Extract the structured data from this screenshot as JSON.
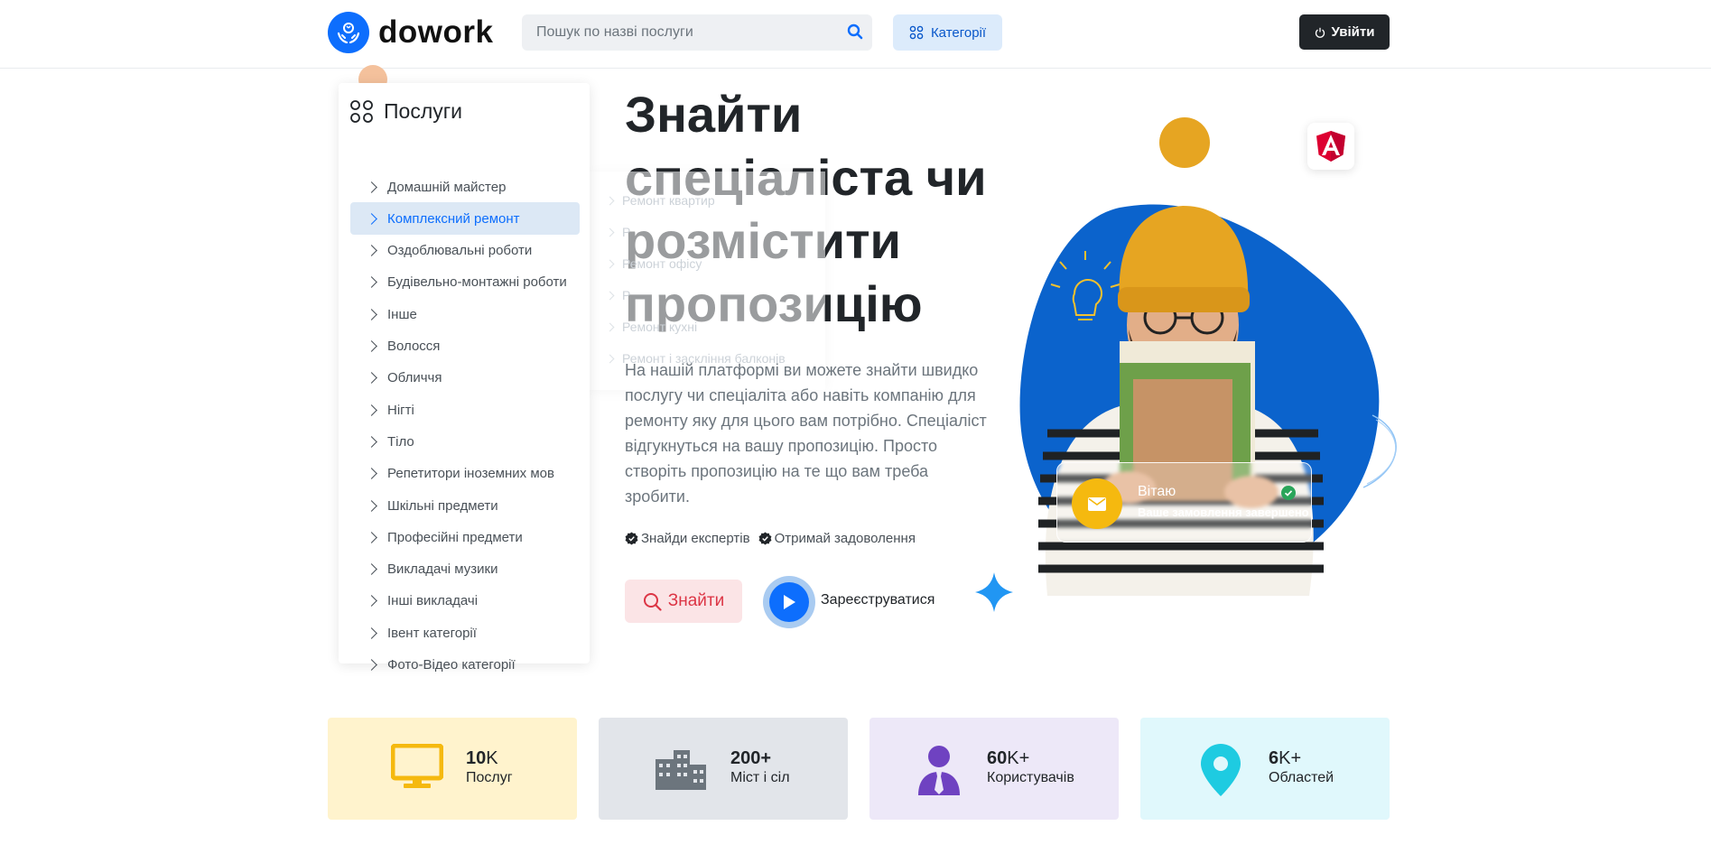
{
  "header": {
    "brand": "dowork",
    "search_placeholder": "Пошук по назві послуги",
    "categories_label": "Категорії",
    "login_label": "Увійти"
  },
  "services": {
    "title": "Послуги",
    "items": [
      "Домашній майстер",
      "Комплексний ремонт",
      "Оздоблювальні роботи",
      "Будівельно-монтажні роботи",
      "Інше",
      "Волосся",
      "Обличчя",
      "Нігті",
      "Тіло",
      "Репетитори іноземних мов",
      "Шкільні предмети",
      "Професійні предмети",
      "Викладачі музики",
      "Інші викладачі",
      "Івент категорії",
      "Фото-Відео категорії"
    ],
    "active_index": 1
  },
  "submenu": {
    "items": [
      "Ремонт квартир",
      "Р",
      "Ремонт офісу",
      "Р",
      "Ремонт кухні",
      "Ремонт і заскління балконів"
    ]
  },
  "hero": {
    "title": "Знайти спеціаліста чи розмістити пропозицію",
    "description": "На нашій платформі ви можете знайти швидко послугу чи спеціаліта або навіть компанію для ремонту яку для цього вам потрібно. Спеціаліст відгукнуться на вашу пропозицію. Просто створіть пропозицію на те що вам треба зробити.",
    "check1": "Знайди експертів",
    "check2": "Отримай задоволення",
    "find_label": "Знайти",
    "register_label": "Зареєструватися"
  },
  "notification": {
    "title": "Вітаю",
    "subtitle": "Ваше замовлення завершено"
  },
  "stats": [
    {
      "bold": "10",
      "suffix": "K",
      "label": "Послуг",
      "bg": "#fff3cd",
      "icon_color": "#f5b90f",
      "icon": "monitor-icon"
    },
    {
      "bold": "200+",
      "suffix": "",
      "label": "Міст і сіл",
      "bg": "#e2e5ea",
      "icon_color": "#6c757d",
      "icon": "city-icon"
    },
    {
      "bold": "60",
      "suffix": "K+",
      "label": "Користувачів",
      "bg": "#ede8f8",
      "icon_color": "#6f42c1",
      "icon": "user-tie-icon"
    },
    {
      "bold": "6",
      "suffix": "K+",
      "label": "Областей",
      "bg": "#e0f8fc",
      "icon_color": "#1ecbe1",
      "icon": "location-pin-icon"
    }
  ],
  "colors": {
    "primary": "#0d6efd",
    "dark": "#212529",
    "danger": "#dc3545",
    "warning": "#f5b90f"
  }
}
